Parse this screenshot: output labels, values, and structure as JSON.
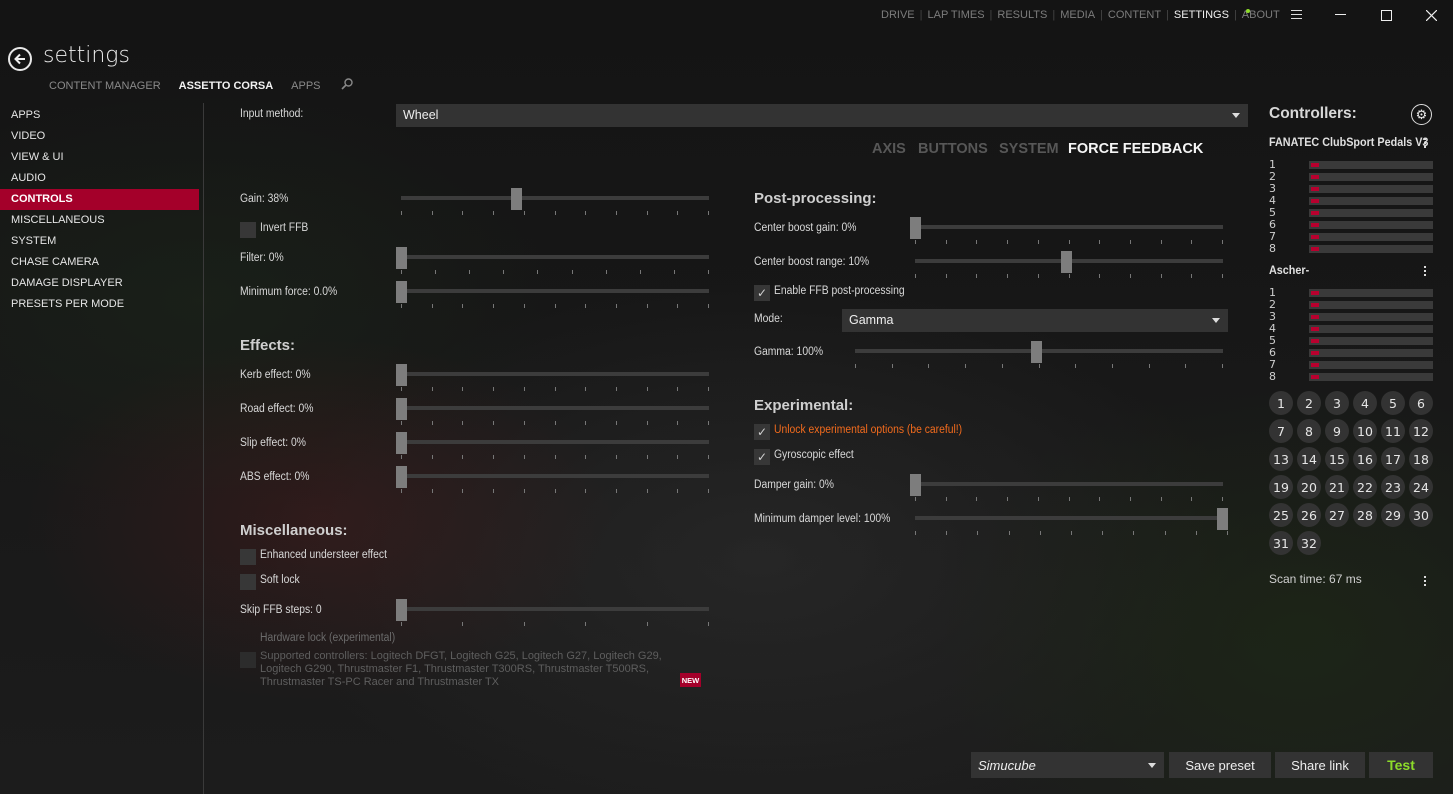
{
  "topnav": {
    "items": [
      "DRIVE",
      "LAP TIMES",
      "RESULTS",
      "MEDIA",
      "CONTENT",
      "SETTINGS",
      "ABOUT"
    ],
    "active": "SETTINGS",
    "about_indicator_color": "#8ddc2a"
  },
  "window": {
    "menu_icon": "hamburger-icon",
    "minimize_icon": "minimize-icon",
    "maximize_icon": "maximize-icon",
    "close_icon": "close-icon"
  },
  "header": {
    "title": "settings",
    "subtabs": [
      "CONTENT MANAGER",
      "ASSETTO CORSA",
      "APPS"
    ],
    "active_subtab": "ASSETTO CORSA",
    "search_icon": "search-icon"
  },
  "sidebar": {
    "items": [
      "APPS",
      "VIDEO",
      "VIEW & UI",
      "AUDIO",
      "CONTROLS",
      "MISCELLANEOUS",
      "SYSTEM",
      "CHASE CAMERA",
      "DAMAGE DISPLAYER",
      "PRESETS PER MODE"
    ],
    "active": "CONTROLS",
    "accent_color": "#a4002a"
  },
  "input": {
    "label": "Input method:",
    "value": "Wheel"
  },
  "control_tabs": {
    "items": [
      "AXIS",
      "BUTTONS",
      "SYSTEM",
      "FORCE FEEDBACK"
    ],
    "active": "FORCE FEEDBACK"
  },
  "ffb": {
    "gain": {
      "label": "Gain: 38%",
      "value_pct": 38
    },
    "invert": {
      "label": "Invert FFB",
      "checked": false
    },
    "filter": {
      "label": "Filter: 0%",
      "value_pct": 0
    },
    "min_force": {
      "label": "Minimum force: 0.0%",
      "value_pct": 0
    }
  },
  "effects": {
    "title": "Effects:",
    "kerb": {
      "label": "Kerb effect: 0%",
      "value_pct": 0
    },
    "road": {
      "label": "Road effect: 0%",
      "value_pct": 0
    },
    "slip": {
      "label": "Slip effect: 0%",
      "value_pct": 0
    },
    "abs": {
      "label": "ABS effect: 0%",
      "value_pct": 0
    }
  },
  "misc": {
    "title": "Miscellaneous:",
    "understeer": {
      "label": "Enhanced understeer effect",
      "checked": false
    },
    "softlock": {
      "label": "Soft lock",
      "checked": false
    },
    "skip_steps": {
      "label": "Skip FFB steps: 0",
      "value": 0
    },
    "hwlock": {
      "label": "Hardware lock (experimental)",
      "description": "Supported controllers: Logitech DFGT, Logitech G25, Logitech G27, Logitech G29, Logitech G290, Thrustmaster F1, Thrustmaster T300RS, Thrustmaster T500RS, Thrustmaster TS-PC Racer and Thrustmaster TX",
      "badge": "NEW",
      "checked": false,
      "disabled": true
    }
  },
  "post": {
    "title": "Post-processing:",
    "center_gain": {
      "label": "Center boost gain: 0%",
      "value_pct": 0
    },
    "center_range": {
      "label": "Center boost range: 10%",
      "value_pct": 50
    },
    "enable": {
      "label": "Enable FFB post-processing",
      "checked": true
    },
    "mode": {
      "label": "Mode:",
      "value": "Gamma"
    },
    "gamma": {
      "label": "Gamma: 100%",
      "value_pct": 50
    }
  },
  "experimental": {
    "title": "Experimental:",
    "unlock": {
      "label": "Unlock experimental options (be careful!)",
      "checked": true,
      "color": "#f26b1d"
    },
    "gyro": {
      "label": "Gyroscopic effect",
      "checked": true
    },
    "damper_gain": {
      "label": "Damper gain: 0%",
      "value_pct": 0
    },
    "min_damper": {
      "label": "Minimum damper level: 100%",
      "value_pct": 100
    }
  },
  "controllers": {
    "title": "Controllers:",
    "devices": [
      {
        "name": "FANATEC ClubSport Pedals V3",
        "axes": [
          "1",
          "2",
          "3",
          "4",
          "5",
          "6",
          "7",
          "8"
        ]
      },
      {
        "name": "Ascher-",
        "axes": [
          "1",
          "2",
          "3",
          "4",
          "5",
          "6",
          "7",
          "8"
        ]
      }
    ],
    "buttons": [
      "1",
      "2",
      "3",
      "4",
      "5",
      "6",
      "7",
      "8",
      "9",
      "10",
      "11",
      "12",
      "13",
      "14",
      "15",
      "16",
      "17",
      "18",
      "19",
      "20",
      "21",
      "22",
      "23",
      "24",
      "25",
      "26",
      "27",
      "28",
      "29",
      "30",
      "31",
      "32"
    ],
    "scan_time": "Scan time: 67 ms"
  },
  "footer": {
    "preset": "Simucube",
    "save_label": "Save preset",
    "share_label": "Share link",
    "test_label": "Test",
    "test_color": "#8ddc2a"
  }
}
